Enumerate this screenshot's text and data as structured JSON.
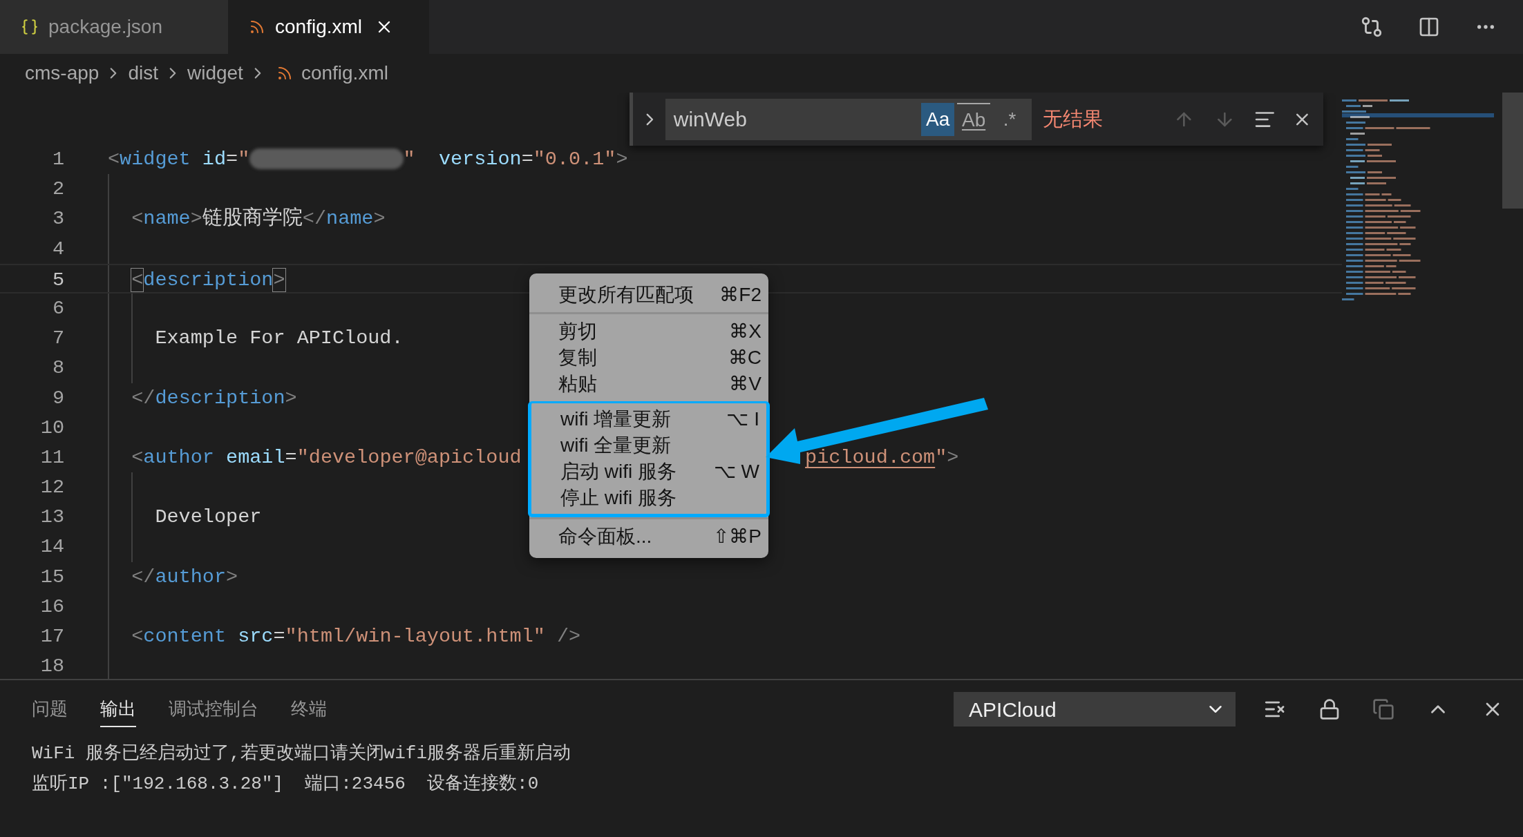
{
  "tabs": [
    {
      "label": "package.json",
      "kind": "json",
      "selected": false
    },
    {
      "label": "config.xml",
      "kind": "xml",
      "selected": true
    }
  ],
  "breadcrumb": [
    {
      "label": "cms-app",
      "kind": "folder"
    },
    {
      "label": "dist",
      "kind": "folder"
    },
    {
      "label": "widget",
      "kind": "folder"
    },
    {
      "label": "config.xml",
      "kind": "xml"
    }
  ],
  "find": {
    "replace_expanded": false,
    "value": "winWeb",
    "toggles": [
      {
        "label": "Aa",
        "kind": "case",
        "selected": true
      },
      {
        "label": "Ab",
        "kind": "word",
        "selected": false
      },
      {
        "label": ".*",
        "kind": "regex",
        "selected": false
      }
    ],
    "result": "无结果",
    "nav": [
      {
        "kind": "up",
        "disabled": true
      },
      {
        "kind": "down",
        "disabled": true
      }
    ]
  },
  "code": [
    {
      "number": "1",
      "current": false,
      "tokens": [
        {
          "kind": "punct",
          "text": "<"
        },
        {
          "kind": "tag",
          "text": "widget"
        },
        {
          "kind": "attr",
          "text": " id"
        },
        {
          "kind": "text",
          "text": "="
        },
        {
          "kind": "string",
          "text": "\""
        },
        {
          "kind": "redacted"
        },
        {
          "kind": "string",
          "text": "\""
        },
        {
          "kind": "attr",
          "text": "  version"
        },
        {
          "kind": "text",
          "text": "="
        },
        {
          "kind": "string",
          "text": "\"0.0.1\""
        },
        {
          "kind": "punct",
          "text": ">"
        }
      ]
    },
    {
      "number": "2",
      "current": false
    },
    {
      "number": "3",
      "current": false,
      "tokens": [
        {
          "kind": "punct",
          "text": "  <"
        },
        {
          "kind": "tag",
          "text": "name"
        },
        {
          "kind": "punct",
          "text": ">"
        },
        {
          "kind": "text",
          "text": "链股商学院"
        },
        {
          "kind": "punct",
          "text": "</"
        },
        {
          "kind": "tag",
          "text": "name"
        },
        {
          "kind": "punct",
          "text": ">"
        }
      ]
    },
    {
      "number": "4",
      "current": false
    },
    {
      "number": "5",
      "current": true,
      "tokens": [
        {
          "kind": "bracket-match",
          "text": "  <"
        },
        {
          "kind": "tag",
          "text": "description"
        },
        {
          "kind": "bracket-match",
          "text": ">"
        }
      ]
    },
    {
      "number": "6",
      "current": false
    },
    {
      "number": "7",
      "current": false,
      "tokens": [
        {
          "kind": "text",
          "text": "    Example For APICloud."
        }
      ]
    },
    {
      "number": "8",
      "current": false
    },
    {
      "number": "9",
      "current": false,
      "tokens": [
        {
          "kind": "punct",
          "text": "  </"
        },
        {
          "kind": "tag",
          "text": "description"
        },
        {
          "kind": "punct",
          "text": ">"
        }
      ]
    },
    {
      "number": "10",
      "current": false
    },
    {
      "number": "11",
      "current": false,
      "tokens": [
        {
          "kind": "punct",
          "text": "  <"
        },
        {
          "kind": "tag",
          "text": "author"
        },
        {
          "kind": "attr",
          "text": " email"
        },
        {
          "kind": "text",
          "text": "="
        },
        {
          "kind": "string",
          "text": "\"developer@apicloud"
        }
      ],
      "tail": [
        {
          "kind": "link",
          "text": "picloud.com"
        },
        {
          "kind": "string",
          "text": "\""
        },
        {
          "kind": "punct",
          "text": ">"
        }
      ]
    },
    {
      "number": "12",
      "current": false
    },
    {
      "number": "13",
      "current": false,
      "tokens": [
        {
          "kind": "text",
          "text": "    Developer"
        }
      ]
    },
    {
      "number": "14",
      "current": false
    },
    {
      "number": "15",
      "current": false,
      "tokens": [
        {
          "kind": "punct",
          "text": "  </"
        },
        {
          "kind": "tag",
          "text": "author"
        },
        {
          "kind": "punct",
          "text": ">"
        }
      ]
    },
    {
      "number": "16",
      "current": false
    },
    {
      "number": "17",
      "current": false,
      "tokens": [
        {
          "kind": "punct",
          "text": "  <"
        },
        {
          "kind": "tag",
          "text": "content"
        },
        {
          "kind": "attr",
          "text": " src"
        },
        {
          "kind": "text",
          "text": "="
        },
        {
          "kind": "string",
          "text": "\"html/win-layout.html\""
        },
        {
          "kind": "punct",
          "text": " />"
        }
      ]
    },
    {
      "number": "18",
      "current": false
    }
  ],
  "context_menu": [
    {
      "highlighted": false,
      "items": [
        {
          "label": "更改所有匹配项",
          "shortcut": "⌘F2"
        }
      ]
    },
    {
      "highlighted": false,
      "items": [
        {
          "label": "剪切",
          "shortcut": "⌘X"
        },
        {
          "label": "复制",
          "shortcut": "⌘C"
        },
        {
          "label": "粘贴",
          "shortcut": "⌘V"
        }
      ]
    },
    {
      "highlighted": true,
      "items": [
        {
          "label": "wifi 增量更新",
          "shortcut": "⌥ I"
        },
        {
          "label": "wifi 全量更新"
        },
        {
          "label": "启动 wifi 服务",
          "shortcut": "⌥ W"
        },
        {
          "label": "停止 wifi 服务"
        }
      ]
    },
    {
      "highlighted": false,
      "items": [
        {
          "label": "命令面板...",
          "shortcut": "⇧⌘P"
        }
      ]
    }
  ],
  "panel": {
    "tabs": [
      {
        "label": "问题",
        "selected": false
      },
      {
        "label": "输出",
        "selected": true
      },
      {
        "label": "调试控制台",
        "selected": false
      },
      {
        "label": "终端",
        "selected": false
      }
    ],
    "channel": "APICloud",
    "output": [
      "WiFi 服务已经启动过了,若更改端口请关闭wifi服务器后重新启动",
      "监听IP :[\"192.168.3.28\"]  端口:23456  设备连接数:0"
    ]
  }
}
